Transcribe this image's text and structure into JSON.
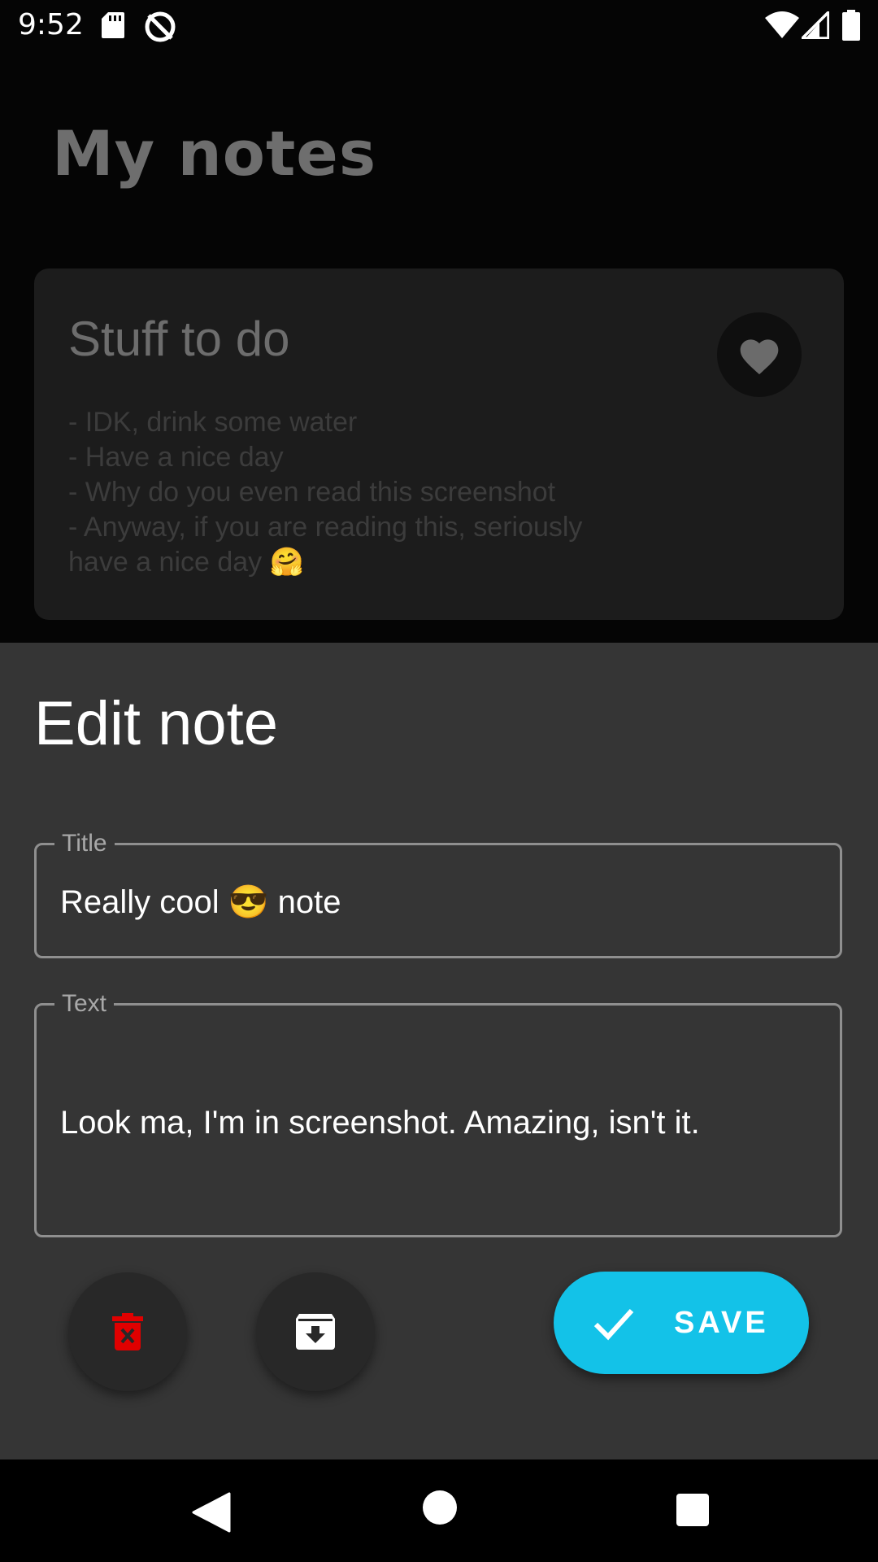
{
  "status_bar": {
    "time": "9:52",
    "icons": [
      "sd-card-icon",
      "sync-disabled-icon",
      "wifi-icon",
      "cell-signal-icon",
      "battery-icon"
    ]
  },
  "background": {
    "title": "My notes",
    "note": {
      "title": "Stuff to do",
      "body": "- IDK, drink some water\n- Have a nice day\n- Why do you even read this screenshot\n- Anyway, if you are reading this, seriously\nhave a nice day 🤗",
      "favorite_icon": "heart-icon"
    }
  },
  "sheet": {
    "title": "Edit note",
    "title_field": {
      "label": "Title",
      "value": "Really cool 😎 note"
    },
    "text_field": {
      "label": "Text",
      "value": "Look ma, I'm in screenshot. Amazing, isn't it."
    },
    "actions": {
      "delete_icon": "trash-icon",
      "archive_icon": "archive-icon",
      "save_label": "SAVE",
      "save_icon": "check-icon"
    }
  },
  "nav_bar": {
    "icons": [
      "back-icon",
      "home-icon",
      "recents-icon"
    ]
  },
  "colors": {
    "accent": "#13c2e8",
    "sheet_background": "#353535",
    "delete_icon": "#e00000"
  }
}
